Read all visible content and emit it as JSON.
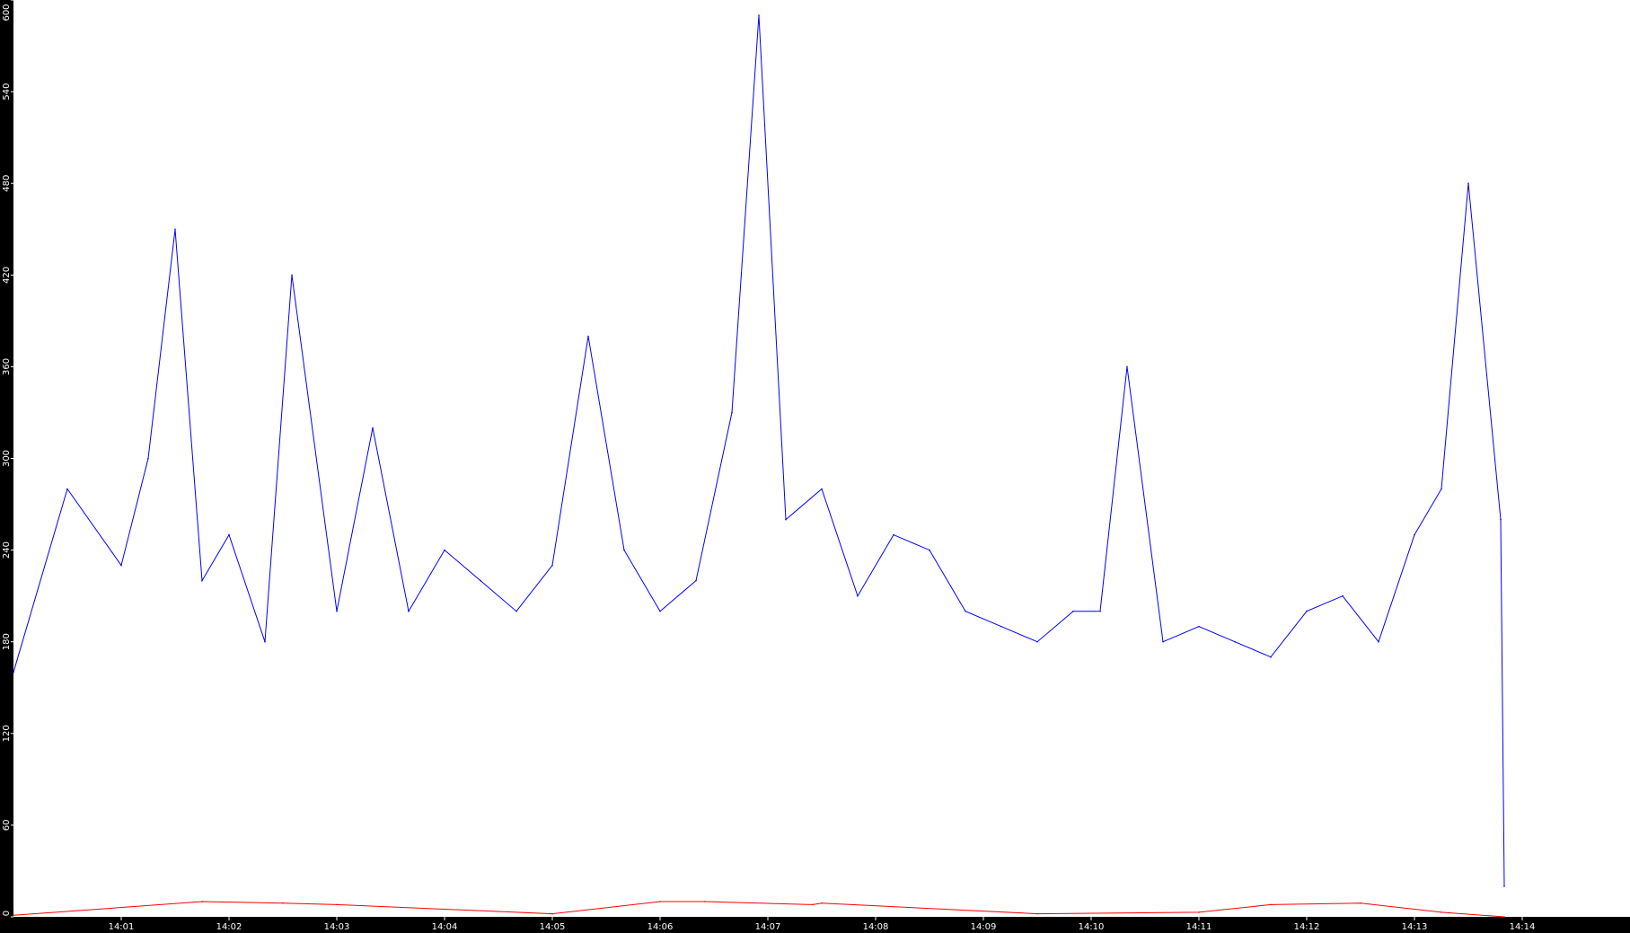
{
  "chart_data": {
    "type": "line",
    "title": "",
    "xlabel": "",
    "ylabel": "",
    "ylim": [
      0,
      600
    ],
    "y_ticks": [
      0,
      60,
      120,
      180,
      240,
      300,
      360,
      420,
      480,
      540,
      600
    ],
    "y_tick_labels": [
      "0",
      "60",
      "120",
      "180",
      "240",
      "300",
      "360",
      "420",
      "480",
      "540",
      "600"
    ],
    "x_range_minutes": [
      14.0,
      14.0
    ],
    "x_start": "14:00:00",
    "x_end": "14:14:30",
    "x_ticks": [
      "14:01",
      "14:02",
      "14:03",
      "14:04",
      "14:05",
      "14:06",
      "14:07",
      "14:08",
      "14:09",
      "14:10",
      "14:11",
      "14:12",
      "14:13",
      "14:14"
    ],
    "grid": false,
    "legend": "none",
    "series": [
      {
        "color": "#0000ff",
        "x": [
          "14:00:00",
          "14:00:30",
          "14:01:00",
          "14:01:15",
          "14:01:30",
          "14:01:45",
          "14:02:00",
          "14:02:20",
          "14:02:35",
          "14:03:00",
          "14:03:20",
          "14:03:40",
          "14:04:00",
          "14:04:20",
          "14:04:40",
          "14:05:00",
          "14:05:20",
          "14:05:40",
          "14:06:00",
          "14:06:20",
          "14:06:40",
          "14:06:55",
          "14:07:10",
          "14:07:30",
          "14:07:50",
          "14:08:10",
          "14:08:30",
          "14:08:50",
          "14:09:10",
          "14:09:30",
          "14:09:50",
          "14:10:05",
          "14:10:20",
          "14:10:40",
          "14:11:00",
          "14:11:20",
          "14:11:40",
          "14:12:00",
          "14:12:20",
          "14:12:40",
          "14:13:00",
          "14:13:15",
          "14:13:30",
          "14:13:48",
          "14:13:50"
        ],
        "values": [
          160,
          280,
          230,
          300,
          450,
          220,
          250,
          180,
          420,
          200,
          320,
          200,
          240,
          220,
          200,
          230,
          380,
          240,
          200,
          220,
          330,
          590,
          260,
          280,
          210,
          250,
          240,
          200,
          190,
          180,
          200,
          200,
          360,
          180,
          190,
          180,
          170,
          200,
          210,
          180,
          250,
          280,
          480,
          260,
          20
        ]
      },
      {
        "color": "#ff0000",
        "x": [
          "14:00:00",
          "14:01:45",
          "14:02:30",
          "14:03:00",
          "14:05:00",
          "14:06:00",
          "14:06:25",
          "14:07:25",
          "14:07:30",
          "14:09:30",
          "14:11:00",
          "14:11:40",
          "14:12:30",
          "14:13:15",
          "14:13:50"
        ],
        "values": [
          1,
          10,
          9,
          8,
          2,
          10,
          10,
          8,
          9,
          2,
          3,
          8,
          9,
          3,
          0
        ]
      }
    ]
  }
}
